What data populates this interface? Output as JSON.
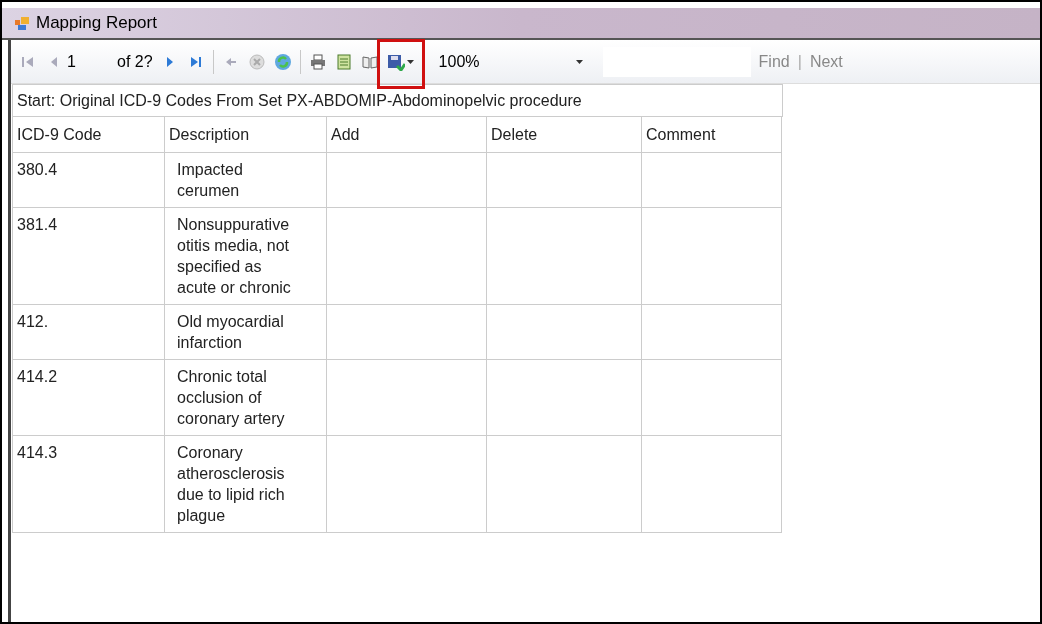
{
  "window": {
    "title": "Mapping Report"
  },
  "toolbar": {
    "page": "1",
    "page_count": "of 2?",
    "zoom": "100%",
    "find_label": "Find",
    "separator": "|",
    "next_label": "Next"
  },
  "report": {
    "heading": "Start: Original ICD-9 Codes From Set PX-ABDOMIP-Abdominopelvic procedure",
    "columns": [
      "ICD-9 Code",
      "Description",
      "Add",
      "Delete",
      "Comment"
    ],
    "rows": [
      {
        "code": "380.4",
        "description": "Impacted cerumen"
      },
      {
        "code": "381.4",
        "description": "Nonsuppurative otitis media, not specified as acute or chronic"
      },
      {
        "code": "412.",
        "description": "Old myocardial infarction"
      },
      {
        "code": "414.2",
        "description": "Chronic total occlusion of coronary artery"
      },
      {
        "code": "414.3",
        "description": "Coronary atherosclerosis due to lipid rich plague"
      }
    ]
  }
}
